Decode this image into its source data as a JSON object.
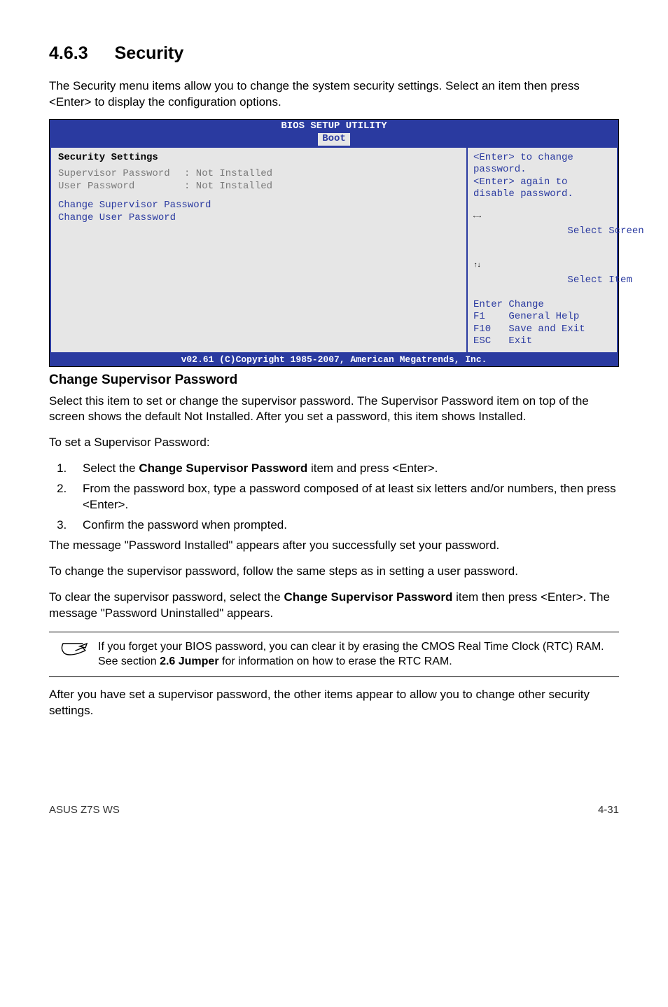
{
  "section": {
    "number": "4.6.3",
    "title": "Security"
  },
  "intro": "The Security menu items allow you to change the system security settings. Select an item then press <Enter> to display the configuration options.",
  "bios": {
    "title": "BIOS SETUP UTILITY",
    "tab": "Boot",
    "left": {
      "header": "Security Settings",
      "rows": [
        {
          "label": "Supervisor Password",
          "value": ": Not Installed"
        },
        {
          "label": "User Password",
          "value": ": Not Installed"
        }
      ],
      "links": [
        "Change Supervisor Password",
        "Change User Password"
      ]
    },
    "right": {
      "desc1": "<Enter> to change",
      "desc2": "password.",
      "desc3": "<Enter> again to",
      "desc4": "disable password.",
      "keys": {
        "k1": "      Select Screen",
        "k2": "      Select Item",
        "k3": "Enter Change",
        "k4": "F1    General Help",
        "k5": "F10   Save and Exit",
        "k6": "ESC   Exit"
      }
    },
    "footer": "v02.61 (C)Copyright 1985-2007, American Megatrends, Inc."
  },
  "change_sup": {
    "heading": "Change Supervisor Password",
    "p1": "Select this item to set or change the supervisor password. The Supervisor Password item on top of the screen shows the default Not Installed. After you set a password, this item shows Installed.",
    "p2": "To set a Supervisor Password:",
    "steps": {
      "s1a": "Select the ",
      "s1b": "Change Supervisor Password",
      "s1c": " item and press <Enter>.",
      "s2": "From the password box, type a password composed of at least six letters and/or numbers, then press <Enter>.",
      "s3": "Confirm the password when prompted."
    },
    "p3": "The message \"Password Installed\" appears after you successfully set your password.",
    "p4": "To change the supervisor password, follow the same steps as in setting a user password.",
    "p5a": "To clear the supervisor password, select the ",
    "p5b": "Change Supervisor Password",
    "p5c": " item then press <Enter>. The message \"Password Uninstalled\" appears.",
    "note_a": "If you forget your BIOS password, you can clear it by erasing the CMOS Real Time Clock (RTC) RAM. See section ",
    "note_b": "2.6 Jumper",
    "note_c": " for information on how to erase the RTC RAM.",
    "p6": "After you have set a supervisor password, the other items appear to allow you to change other security settings."
  },
  "footer": {
    "left": "ASUS Z7S WS",
    "right": "4-31"
  }
}
